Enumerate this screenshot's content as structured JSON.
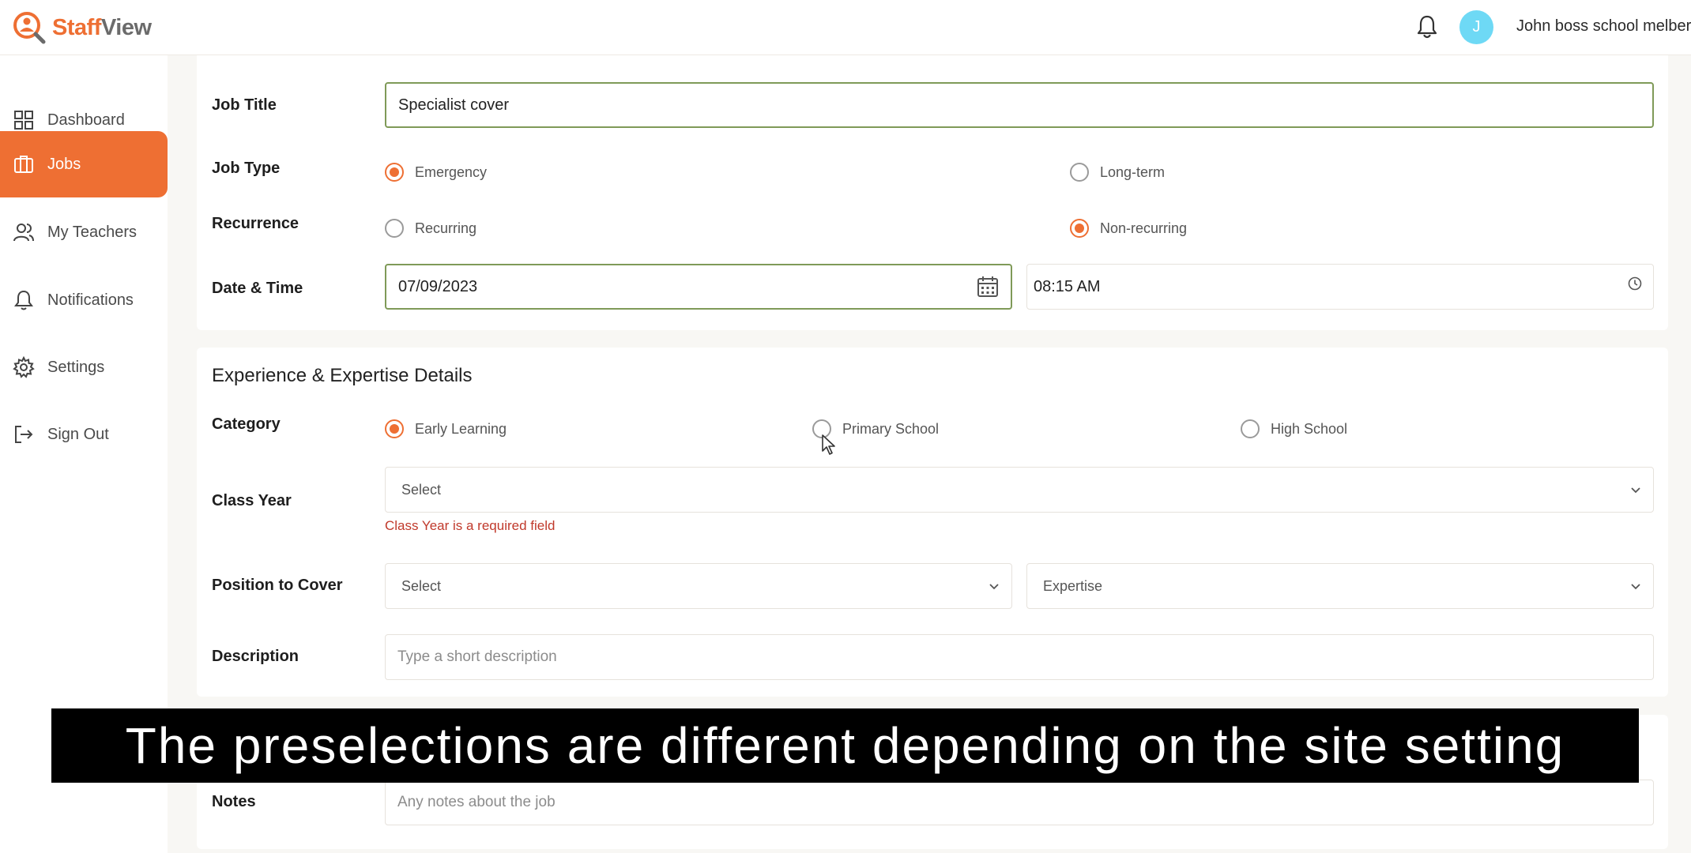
{
  "app": {
    "logo_part1": "Staff",
    "logo_part2": "View",
    "user_name": "John boss school melbern",
    "avatar_initial": "J",
    "brand_color": "#ee6f33"
  },
  "sidebar": {
    "items": [
      {
        "label": "Dashboard",
        "icon": "grid-icon",
        "active": false
      },
      {
        "label": "Jobs",
        "icon": "briefcase-icon",
        "active": true
      },
      {
        "label": "My Teachers",
        "icon": "users-icon",
        "active": false
      },
      {
        "label": "Notifications",
        "icon": "bell-icon",
        "active": false
      },
      {
        "label": "Settings",
        "icon": "gear-icon",
        "active": false
      },
      {
        "label": "Sign Out",
        "icon": "sign-out-icon",
        "active": false
      }
    ]
  },
  "job": {
    "title_label": "Job Title",
    "title_value": "Specialist cover",
    "type_label": "Job Type",
    "type_options": [
      "Emergency",
      "Long-term"
    ],
    "type_selected": "Emergency",
    "recurrence_label": "Recurrence",
    "recurrence_options": [
      "Recurring",
      "Non-recurring"
    ],
    "recurrence_selected": "Non-recurring",
    "datetime_label": "Date & Time",
    "date_value": "07/09/2023",
    "time_value": "08:15 AM"
  },
  "experience": {
    "section_title": "Experience & Expertise Details",
    "category_label": "Category",
    "category_options": [
      "Early Learning",
      "Primary School",
      "High School"
    ],
    "category_selected": "Early Learning",
    "class_year_label": "Class Year",
    "class_year_placeholder": "Select",
    "class_year_error": "Class Year is a required field",
    "position_label": "Position to Cover",
    "position_placeholder": "Select",
    "expertise_placeholder": "Expertise",
    "description_label": "Description",
    "description_placeholder": "Type a short description"
  },
  "notes": {
    "label": "Notes",
    "placeholder": "Any notes about the job"
  },
  "caption": "The preselections are different depending on the site setting"
}
